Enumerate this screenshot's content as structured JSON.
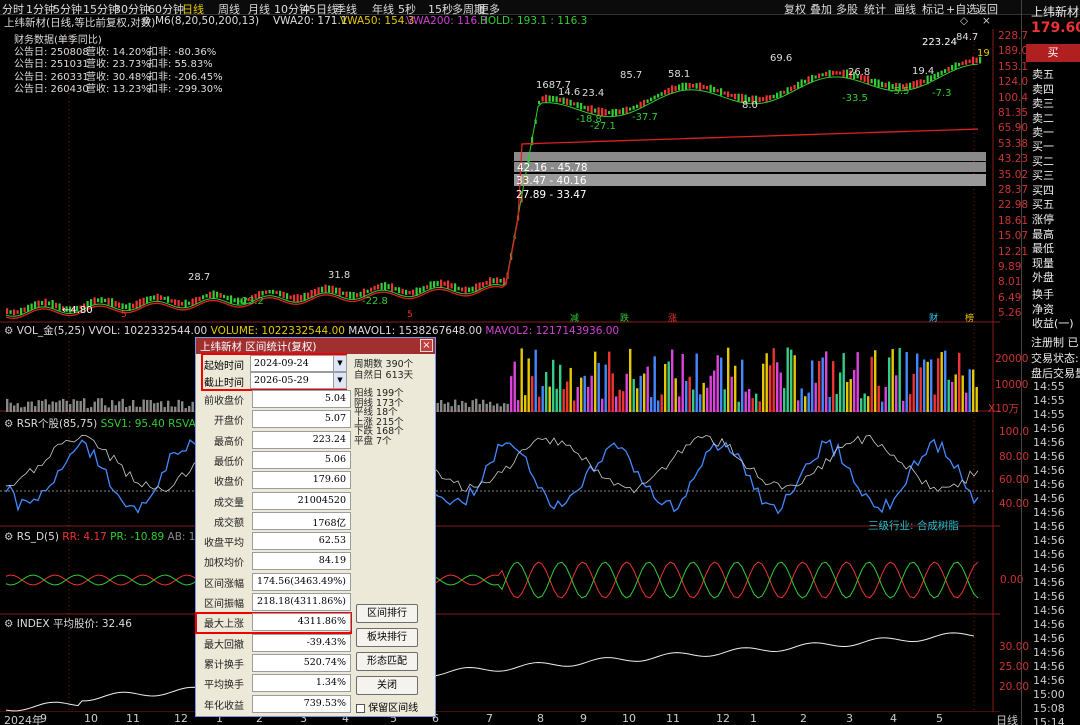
{
  "toolbar": {
    "periods": [
      "分时",
      "1分钟",
      "5分钟",
      "15分钟",
      "30分钟",
      "60分钟",
      "日线",
      "周线",
      "月线",
      "10分钟",
      "45日线",
      "季线",
      "年线",
      "5秒",
      "15秒",
      "多周期",
      "更多"
    ],
    "active_period": "日线",
    "right_items": [
      "复权",
      "叠加",
      "多股",
      "统计",
      "画线",
      "标记",
      "+自选",
      "返回"
    ]
  },
  "chart_title": {
    "stock": "上纬新材(日线,等比前复权,对数)",
    "m6": "M6(8,20,50,200,13)",
    "vwa20": "VWA20: 171.1",
    "vwa50": "VWA50: 154.3",
    "vwa200": "VWA200: 116.3",
    "hold": "HOLD: 193.1 : 116.3"
  },
  "finance": {
    "header": "财务数据(单季同比)",
    "rows": [
      {
        "date": "公告日: 250808",
        "rev": "营收: 14.20%",
        "deduct": "扣非: -80.36%"
      },
      {
        "date": "公告日: 251031",
        "rev": "营收: 23.73%",
        "deduct": "扣非: 55.83%"
      },
      {
        "date": "公告日: 260331",
        "rev": "营收: 30.48%",
        "deduct": "扣非: -206.45%"
      },
      {
        "date": "公告日: 260430",
        "rev": "营收: 13.23%",
        "deduct": "扣非: -299.30%"
      }
    ]
  },
  "price_axis": [
    "228.7",
    "189.0",
    "153.1",
    "124.0",
    "100.4",
    "81.35",
    "65.90",
    "53.38",
    "43.23",
    "35.02",
    "28.37",
    "22.98",
    "18.61",
    "15.07",
    "12.21",
    "9.89",
    "8.01",
    "6.49",
    "5.26"
  ],
  "price_annotations": {
    "low": "4.80",
    "high": "223.24",
    "labels": [
      "28.7",
      "31.8",
      "-23.2",
      "-22.8",
      "1687.7",
      "14.6",
      "23.4",
      "85.7",
      "58.1",
      "69.6",
      "26.8",
      "19.4",
      "-27.1",
      "-37.7",
      "-18.8",
      "-33.5",
      "-5.5",
      "-7.3",
      "8.0",
      "84.7",
      "19"
    ]
  },
  "ranges": [
    "42.16 - 45.78",
    "33.47 - 40.16",
    "27.89 - 33.47"
  ],
  "markers": [
    "5",
    "5",
    "减",
    "跌",
    "涨",
    "财",
    "榜"
  ],
  "vol": {
    "name": "VOL_金(5,25)",
    "vvol": "VVOL: 1022332544.00",
    "volume": "VOLUME: 1022332544.00",
    "mavol1": "MAVOL1: 1538267648.00",
    "mavol2": "MAVOL2: 1217143936.00",
    "axis": [
      "20000",
      "10000"
    ],
    "unit": "X10万"
  },
  "rsr": {
    "name": "RSR个股(85,75)",
    "ssv1": "SSV1: 95.40",
    "rsva": "RSVA: 64.0",
    "axis": [
      "100.0",
      "80.00",
      "60.00",
      "40.00"
    ],
    "industry": "三级行业: 合成树脂"
  },
  "rsd": {
    "name": "RS_D(5)",
    "rr": "RR: 4.17",
    "pr": "PR: -10.89",
    "ab": "AB: 17.00",
    "a": "A",
    "axis": [
      "0.00"
    ]
  },
  "index": {
    "name": "INDEX",
    "avg": "平均股价: 32.46",
    "axis": [
      "30.00",
      "25.00",
      "20.00"
    ]
  },
  "x_axis": [
    "2024年",
    "9",
    "10",
    "11",
    "12",
    "1",
    "2",
    "3",
    "4",
    "5",
    "6",
    "7",
    "8",
    "9",
    "10",
    "11",
    "12",
    "1",
    "2",
    "3",
    "4",
    "5"
  ],
  "x_end": "日线",
  "right_panel": {
    "name": "上纬新材",
    "price": "179.60",
    "sell_btn": "买",
    "sells": [
      "卖五",
      "卖四",
      "卖三",
      "卖二",
      "卖一"
    ],
    "buys": [
      "买一",
      "买二",
      "买三",
      "买四",
      "买五"
    ],
    "stats": [
      "涨停",
      "最高",
      "最低",
      "现量",
      "外盘"
    ],
    "extra": [
      "换手",
      "净资",
      "收益(一)"
    ],
    "reg": "注册制  已",
    "status": "交易状态:",
    "after": "盘后交易量",
    "times": [
      "14:55",
      "14:55",
      "14:55",
      "14:56",
      "14:56",
      "14:56",
      "14:56",
      "14:56",
      "14:56",
      "14:56",
      "14:56",
      "14:56",
      "14:56",
      "14:56",
      "14:56",
      "14:56",
      "14:56",
      "14:56",
      "14:56",
      "14:56",
      "14:56",
      "14:56",
      "15:00",
      "15:08",
      "15:14"
    ]
  },
  "dialog": {
    "title": "上纬新材 区间统计(复权)",
    "close": "×",
    "start_label": "起始时间",
    "start_value": "2024-09-24",
    "end_label": "截止时间",
    "end_value": "2026-05-29",
    "period_days": "周期数  390个",
    "natural_days": "自然日  613天",
    "counts": [
      "阳线  199个",
      "阴线  173个",
      "平线  18个",
      "上涨  215个",
      "下跌  168个",
      "平盘  7个"
    ],
    "fields": [
      {
        "label": "前收盘价",
        "value": "5.04"
      },
      {
        "label": "开盘价",
        "value": "5.07"
      },
      {
        "label": "最高价",
        "value": "223.24"
      },
      {
        "label": "最低价",
        "value": "5.06"
      },
      {
        "label": "收盘价",
        "value": "179.60"
      },
      {
        "label": "成交量",
        "value": "21004520"
      },
      {
        "label": "成交额",
        "value": "1768亿"
      },
      {
        "label": "收盘平均",
        "value": "62.53"
      },
      {
        "label": "加权均价",
        "value": "84.19"
      },
      {
        "label": "区间涨幅",
        "value": "174.56(3463.49%)"
      },
      {
        "label": "区间振幅",
        "value": "218.18(4311.86%)"
      },
      {
        "label": "最大上涨",
        "value": "4311.86%"
      },
      {
        "label": "最大回撤",
        "value": "-39.43%"
      },
      {
        "label": "累计换手",
        "value": "520.74%"
      },
      {
        "label": "平均换手",
        "value": "1.34%"
      },
      {
        "label": "年化收益",
        "value": "739.53%"
      }
    ],
    "buttons": [
      "区间排行",
      "板块排行",
      "形态匹配",
      "关闭"
    ],
    "checkbox": "保留区间线"
  }
}
